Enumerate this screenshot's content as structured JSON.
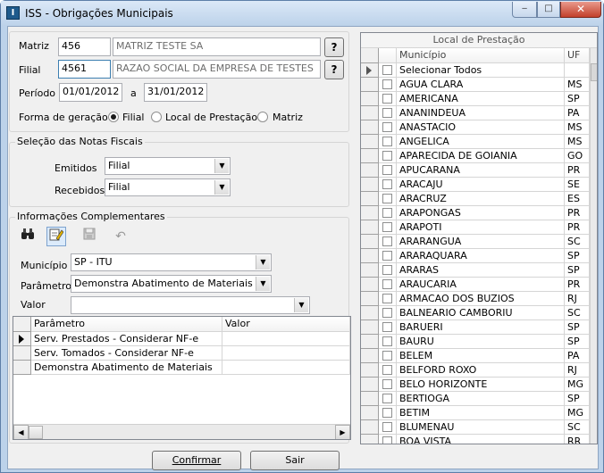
{
  "window": {
    "title": "ISS - Obrigações Municipais",
    "minimize": "‒",
    "maximize": "□",
    "close": "✕",
    "icon_glyph": "I"
  },
  "header": {
    "matriz_label": "Matriz",
    "matriz_code": "456",
    "matriz_name": "MATRIZ TESTE SA",
    "filial_label": "Filial",
    "filial_code": "4561",
    "filial_name": "RAZAO SOCIAL DA EMPRESA DE TESTES",
    "lookup_label": "?",
    "periodo_label": "Período",
    "periodo_start": "01/01/2012",
    "periodo_sep": "a",
    "periodo_end": "31/01/2012",
    "forma_label": "Forma de geração",
    "forma_options": [
      "Filial",
      "Local de Prestação",
      "Matriz"
    ],
    "forma_selected": "Filial"
  },
  "notas": {
    "title": "Seleção das Notas Fiscais",
    "emitidos_label": "Emitidos",
    "emitidos_value": "Filial",
    "recebidos_label": "Recebidos",
    "recebidos_value": "Filial"
  },
  "info": {
    "title": "Informações Complementares",
    "toolbar_icons": [
      "binoculars-icon",
      "edit-icon",
      "save-icon",
      "undo-icon"
    ],
    "municipio_label": "Município",
    "municipio_value": "SP - ITU",
    "parametro_label": "Parâmetro",
    "parametro_value": "Demonstra Abatimento de Materiais",
    "valor_label": "Valor",
    "valor_value": "",
    "grid": {
      "columns": [
        "Parâmetro",
        "Valor"
      ],
      "rows": [
        {
          "parametro": "Serv. Prestados - Considerar NF-e",
          "valor": ""
        },
        {
          "parametro": "Serv. Tomados - Considerar NF-e",
          "valor": ""
        },
        {
          "parametro": "Demonstra Abatimento de Materiais",
          "valor": ""
        }
      ]
    }
  },
  "local": {
    "title": "Local de Prestação",
    "columns": [
      "Município",
      "UF"
    ],
    "select_all": "Selecionar Todos",
    "rows": [
      {
        "municipio": "AGUA CLARA",
        "uf": "MS"
      },
      {
        "municipio": "AMERICANA",
        "uf": "SP"
      },
      {
        "municipio": "ANANINDEUA",
        "uf": "PA"
      },
      {
        "municipio": "ANASTACIO",
        "uf": "MS"
      },
      {
        "municipio": "ANGELICA",
        "uf": "MS"
      },
      {
        "municipio": "APARECIDA DE GOIANIA",
        "uf": "GO"
      },
      {
        "municipio": "APUCARANA",
        "uf": "PR"
      },
      {
        "municipio": "ARACAJU",
        "uf": "SE"
      },
      {
        "municipio": "ARACRUZ",
        "uf": "ES"
      },
      {
        "municipio": "ARAPONGAS",
        "uf": "PR"
      },
      {
        "municipio": "ARAPOTI",
        "uf": "PR"
      },
      {
        "municipio": "ARARANGUA",
        "uf": "SC"
      },
      {
        "municipio": "ARARAQUARA",
        "uf": "SP"
      },
      {
        "municipio": "ARARAS",
        "uf": "SP"
      },
      {
        "municipio": "ARAUCARIA",
        "uf": "PR"
      },
      {
        "municipio": "ARMACAO DOS BUZIOS",
        "uf": "RJ"
      },
      {
        "municipio": "BALNEARIO CAMBORIU",
        "uf": "SC"
      },
      {
        "municipio": "BARUERI",
        "uf": "SP"
      },
      {
        "municipio": "BAURU",
        "uf": "SP"
      },
      {
        "municipio": "BELEM",
        "uf": "PA"
      },
      {
        "municipio": "BELFORD ROXO",
        "uf": "RJ"
      },
      {
        "municipio": "BELO HORIZONTE",
        "uf": "MG"
      },
      {
        "municipio": "BERTIOGA",
        "uf": "SP"
      },
      {
        "municipio": "BETIM",
        "uf": "MG"
      },
      {
        "municipio": "BLUMENAU",
        "uf": "SC"
      },
      {
        "municipio": "BOA VISTA",
        "uf": "RR"
      }
    ]
  },
  "buttons": {
    "confirmar": "Confirmar",
    "sair": "Sair"
  }
}
